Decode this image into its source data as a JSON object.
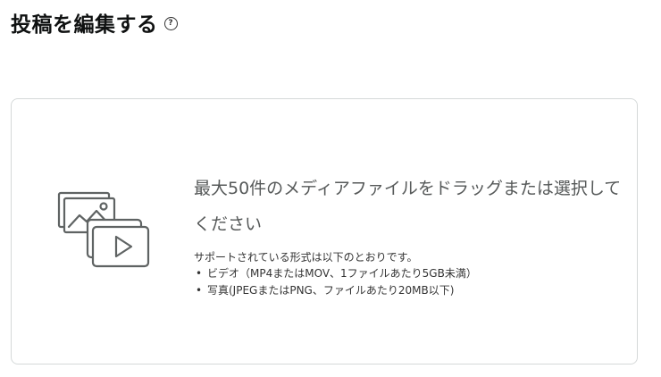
{
  "header": {
    "title": "投稿を編集する",
    "help_icon": "question-circle-icon",
    "help_glyph": "?"
  },
  "upload": {
    "illustration_icon": "media-files-icon",
    "heading": "最大50件のメディアファイルをドラッグまたは選択してください",
    "supported_intro": "サポートされている形式は以下のとおりです。",
    "formats": [
      {
        "bullet": "•",
        "text": "ビデオ（MP4またはMOV、1ファイルあたり5GB未満）"
      },
      {
        "bullet": "•",
        "text": "写真(JPEGまたはPNG、ファイルあたり20MB以下)"
      }
    ]
  },
  "colors": {
    "title": "#0f1111",
    "border": "#d5d9d9",
    "heading_text": "#565959",
    "icon_stroke": "#5f6363"
  }
}
